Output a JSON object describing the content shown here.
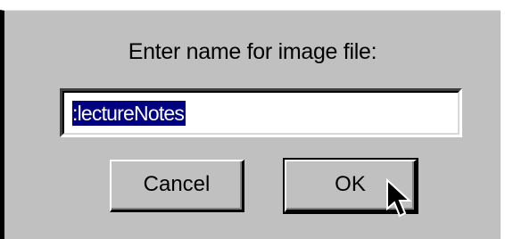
{
  "dialog": {
    "prompt": "Enter name for image file:",
    "filename_value": ":lectureNotes",
    "cancel_label": "Cancel",
    "ok_label": "OK"
  },
  "colors": {
    "dialog_background": "#c0c0c0",
    "selection_background": "#000080",
    "selection_text": "#ffffff"
  },
  "icons": {
    "cursor": "arrow-pointer-icon"
  }
}
